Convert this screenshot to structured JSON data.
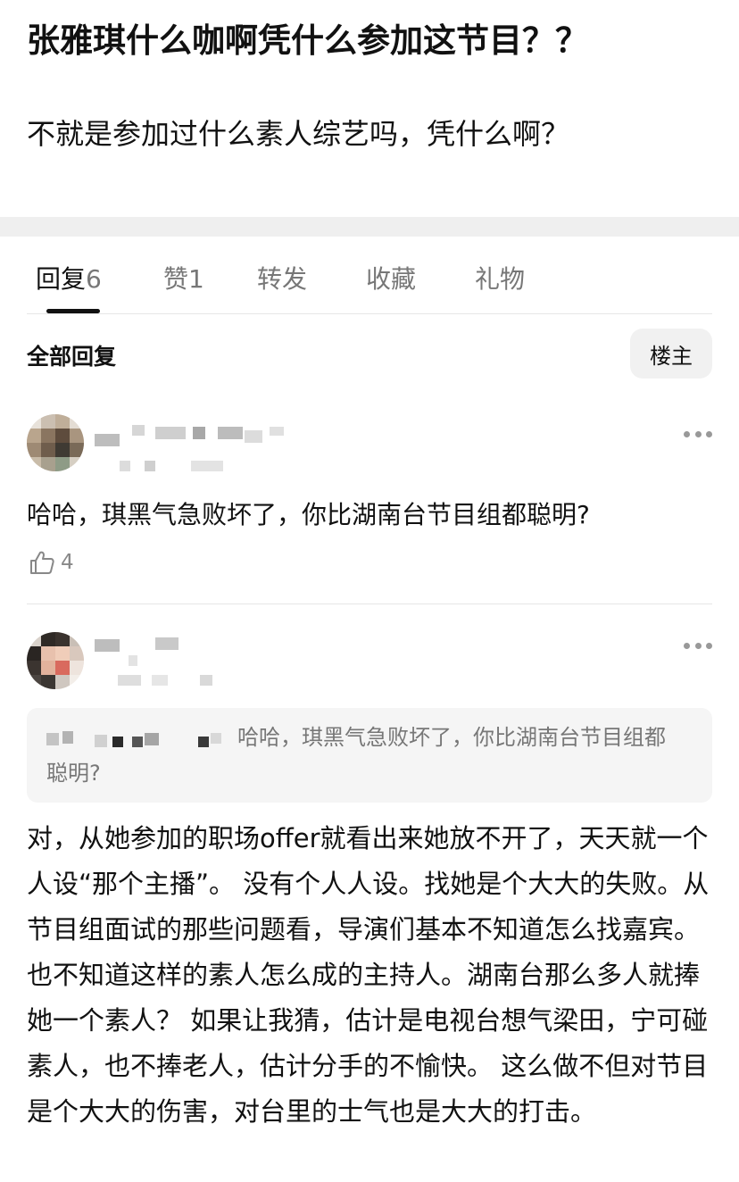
{
  "post": {
    "title": "张雅琪什么咖啊凭什么参加这节目？？",
    "body": "不就是参加过什么素人综艺吗，凭什么啊？"
  },
  "tabs": [
    {
      "label": "回复",
      "count": "6",
      "active": true
    },
    {
      "label": "赞",
      "count": "1",
      "active": false
    },
    {
      "label": "转发",
      "count": "",
      "active": false
    },
    {
      "label": "收藏",
      "count": "",
      "active": false
    },
    {
      "label": "礼物",
      "count": "",
      "active": false
    }
  ],
  "replies_header": {
    "label": "全部回复",
    "op_filter": "楼主"
  },
  "comments": [
    {
      "avatar_icon": "blurred-avatar-icon",
      "text": "哈哈，琪黑气急败坏了，你比湖南台节目组都聪明?",
      "likes": "4"
    },
    {
      "avatar_icon": "blurred-avatar-icon",
      "quote": "哈哈，琪黑气急败坏了，你比湖南台节目组都聪明?",
      "text": "对，从她参加的职场offer就看出来她放不开了，天天就一个人设“那个主播”。 没有个人人设。找她是个大大的失败。从节目组面试的那些问题看，导演们基本不知道怎么找嘉宾。也不知道这样的素人怎么成的主持人。湖南台那么多人就捧她一个素人？ 如果让我猜，估计是电视台想气梁田，宁可碰素人，也不捧老人，估计分手的不愉快。 这么做不但对节目是个大大的伤害，对台里的士气也是大大的打击。"
    }
  ],
  "colors": {
    "text": "#111111",
    "secondary": "#777777",
    "band": "#efefef",
    "quote_bg": "#f5f5f5"
  }
}
